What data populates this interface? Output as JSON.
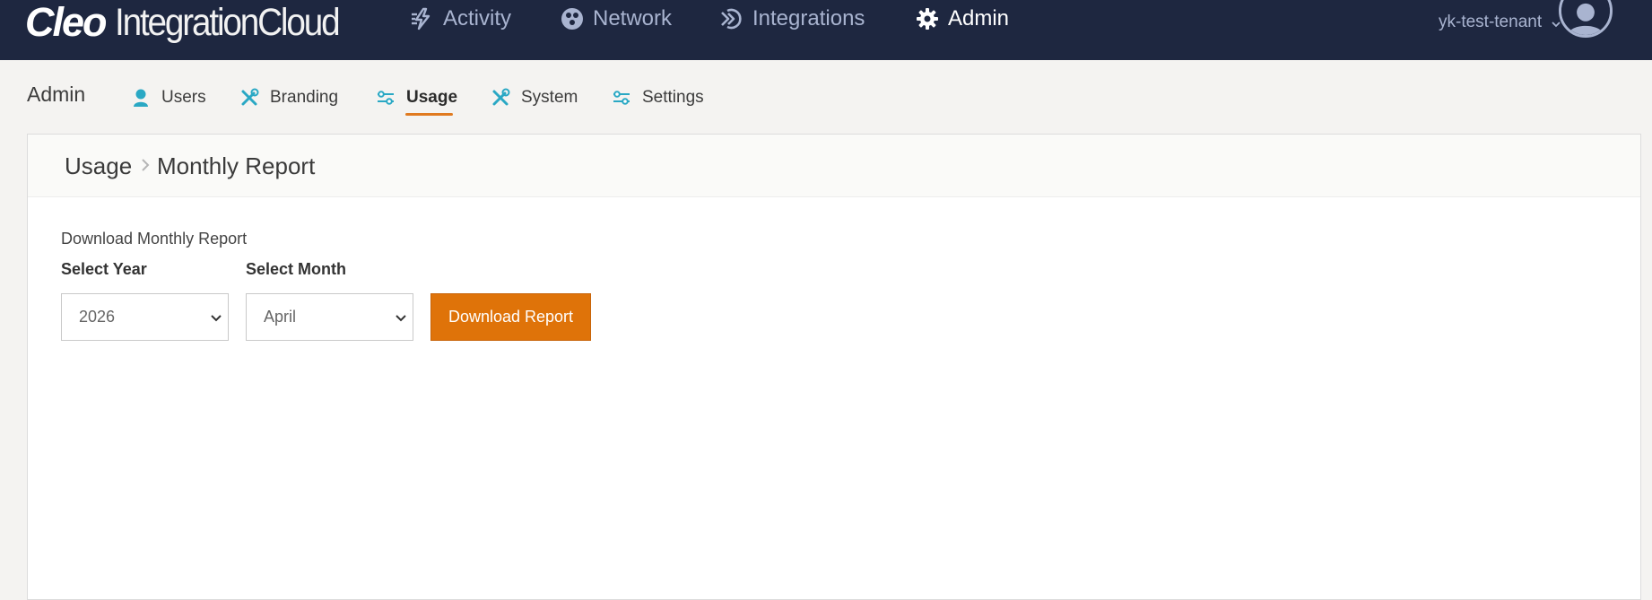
{
  "header": {
    "logo_brand": "Cleo",
    "logo_product": "IntegrationCloud",
    "nav": [
      {
        "label": "Activity",
        "icon": "activity-icon",
        "active": false
      },
      {
        "label": "Network",
        "icon": "network-icon",
        "active": false
      },
      {
        "label": "Integrations",
        "icon": "integrations-icon",
        "active": false
      },
      {
        "label": "Admin",
        "icon": "gear-icon",
        "active": true
      }
    ],
    "tenant": "yk-test-tenant",
    "colors": {
      "background": "#1e2740",
      "nav_text": "#a9b4d0",
      "active_text": "#ffffff"
    }
  },
  "subnav": {
    "title": "Admin",
    "items": [
      {
        "label": "Users",
        "icon": "user-icon",
        "active": false
      },
      {
        "label": "Branding",
        "icon": "tools-icon",
        "active": false
      },
      {
        "label": "Usage",
        "icon": "sliders-icon",
        "active": true
      },
      {
        "label": "System",
        "icon": "tools-icon",
        "active": false
      },
      {
        "label": "Settings",
        "icon": "sliders-icon",
        "active": false
      }
    ],
    "accent_color": "#e07a1f",
    "icon_color": "#2aa8c4"
  },
  "breadcrumb": {
    "parent": "Usage",
    "current": "Monthly Report"
  },
  "report": {
    "caption": "Download Monthly Report",
    "year_label": "Select Year",
    "year_value": "2026",
    "month_label": "Select Month",
    "month_value": "April",
    "download_label": "Download Report",
    "button_color": "#df7309"
  }
}
